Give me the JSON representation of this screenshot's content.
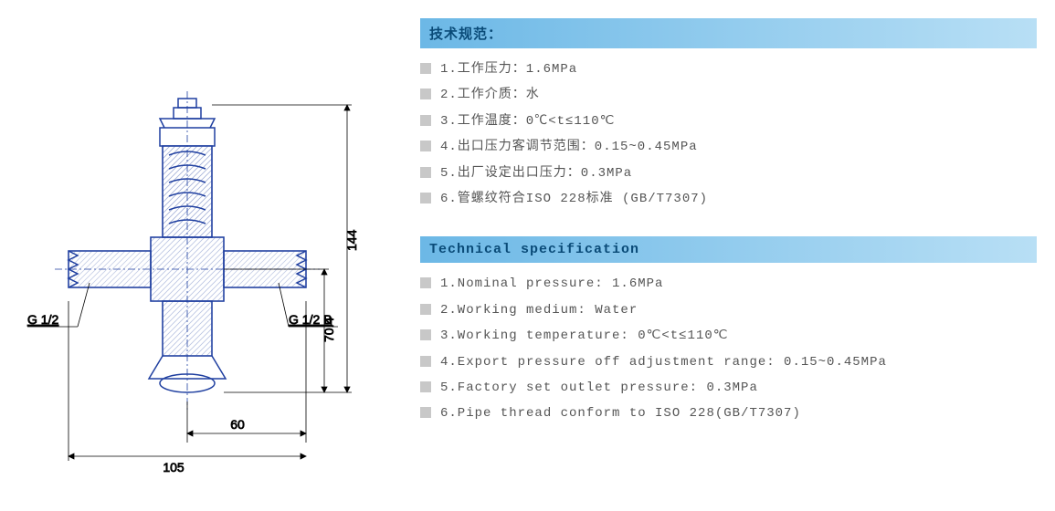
{
  "diagram": {
    "left_thread_label": "G 1/2",
    "right_thread_label": "G 1/2 B",
    "dim_total_width": "105",
    "dim_right_width": "60",
    "dim_lower_height": "70.4",
    "dim_total_height": "144"
  },
  "spec_cn": {
    "header": "技术规范：",
    "items": [
      "1.工作压力：1.6MPa",
      "2.工作介质：水",
      "3.工作温度：0℃<t≤110℃",
      "4.出口压力客调节范围：0.15~0.45MPa",
      "5.出厂设定出口压力：0.3MPa",
      "6.管螺纹符合ISO 228标准 (GB/T7307)"
    ]
  },
  "spec_en": {
    "header": "Technical specification",
    "items": [
      "1.Nominal pressure: 1.6MPa",
      "2.Working medium: Water",
      "3.Working temperature: 0℃<t≤110℃",
      "4.Export pressure off adjustment range: 0.15~0.45MPa",
      "5.Factory set outlet pressure: 0.3MPa",
      "6.Pipe thread conform to ISO 228(GB/T7307)"
    ]
  }
}
